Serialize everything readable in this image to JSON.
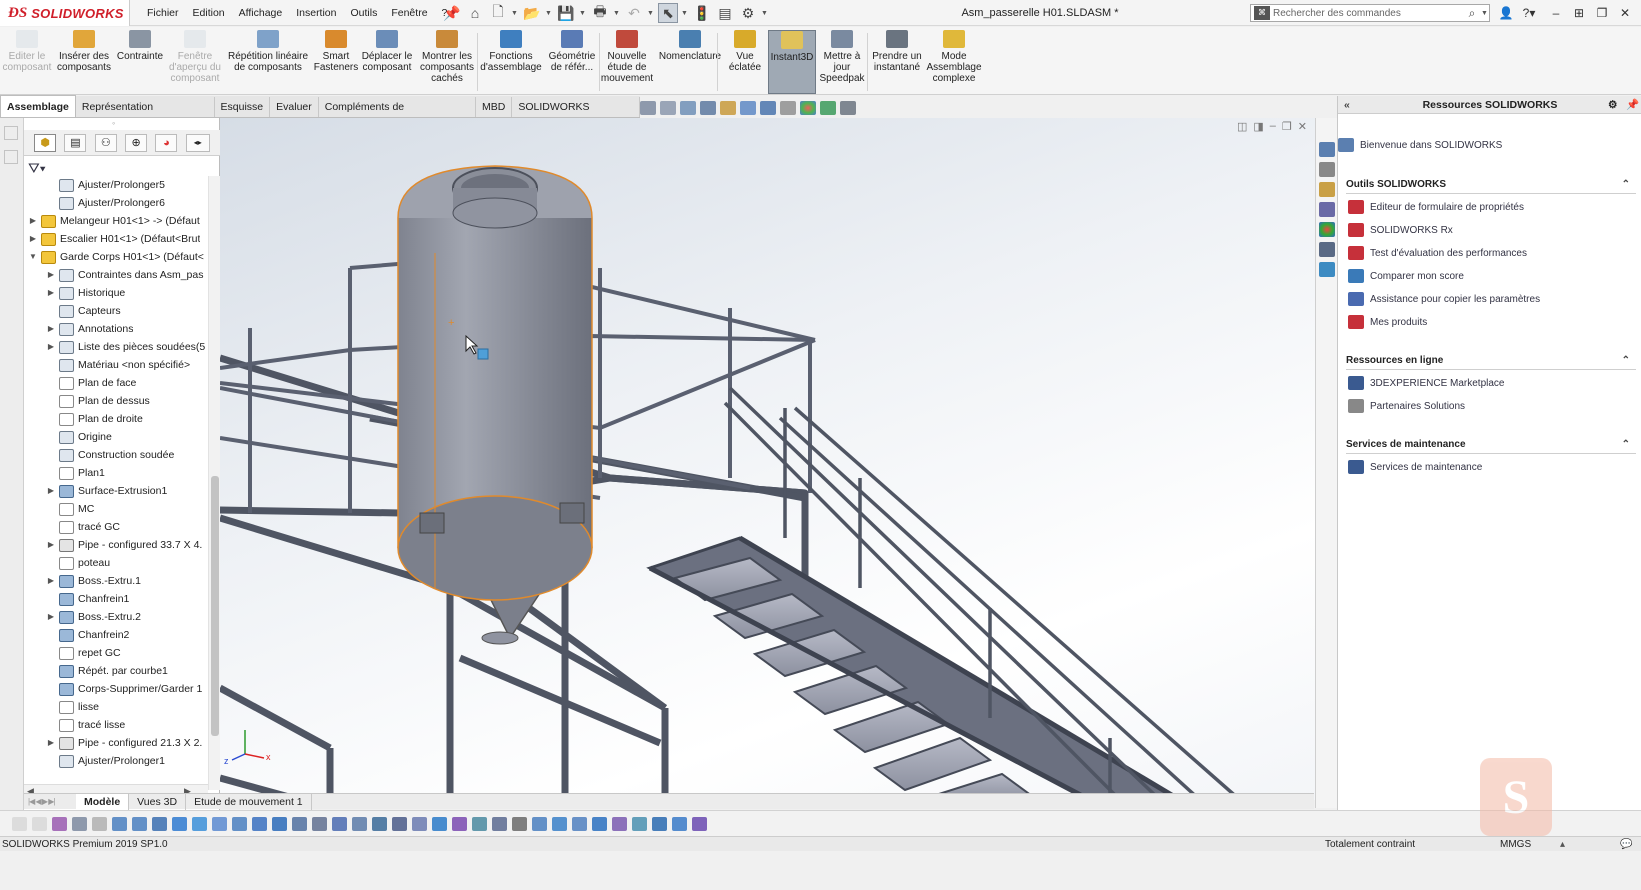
{
  "app": {
    "document_title": "Asm_passerelle H01.SLDASM *"
  },
  "menu": [
    "Fichier",
    "Edition",
    "Affichage",
    "Insertion",
    "Outils",
    "Fenêtre",
    "?"
  ],
  "search": {
    "placeholder": "Rechercher des commandes"
  },
  "commands": [
    {
      "label": "Editer le composant",
      "disabled": true
    },
    {
      "label": "Insérer des composants",
      "disabled": false
    },
    {
      "label": "Contrainte",
      "disabled": false
    },
    {
      "label": "Fenêtre d'aperçu du composant",
      "disabled": true
    },
    {
      "label": "Répétition linéaire de composants",
      "disabled": false
    },
    {
      "label": "Smart Fasteners",
      "disabled": false
    },
    {
      "label": "Déplacer le composant",
      "disabled": false
    },
    {
      "label": "Montrer les composants cachés",
      "disabled": false
    },
    {
      "label": "Fonctions d'assemblage",
      "disabled": false
    },
    {
      "label": "Géométrie de référ...",
      "disabled": false
    },
    {
      "label": "Nouvelle étude de mouvement",
      "disabled": false
    },
    {
      "label": "Nomenclature",
      "disabled": false
    },
    {
      "label": "Vue éclatée",
      "disabled": false
    },
    {
      "label": "Instant3D",
      "disabled": false,
      "active": true
    },
    {
      "label": "Mettre à jour Speedpak",
      "disabled": false
    },
    {
      "label": "Prendre un instantané",
      "disabled": false
    },
    {
      "label": "Mode Assemblage complexe",
      "disabled": false
    }
  ],
  "tabs": [
    "Assemblage",
    "Représentation schématique",
    "Esquisse",
    "Evaluer",
    "Compléments de SOLIDWORKS",
    "MBD",
    "SOLIDWORKS Inspection"
  ],
  "tree": [
    {
      "label": "Ajuster/Prolonger5",
      "indent": 2,
      "icon": "weld-trim-icon",
      "expand": ""
    },
    {
      "label": "Ajuster/Prolonger6",
      "indent": 2,
      "icon": "weld-trim-icon",
      "expand": ""
    },
    {
      "label": "Melangeur H01<1> -> (Défaut",
      "indent": 1,
      "icon": "assembly-icon",
      "expand": "▶"
    },
    {
      "label": "Escalier H01<1> (Défaut<Brut",
      "indent": 1,
      "icon": "assembly-icon",
      "expand": "▶"
    },
    {
      "label": "Garde Corps H01<1> (Défaut<",
      "indent": 1,
      "icon": "assembly-icon",
      "expand": "▼"
    },
    {
      "label": "Contraintes dans Asm_pas",
      "indent": 2,
      "icon": "mates-icon",
      "expand": "▶"
    },
    {
      "label": "Historique",
      "indent": 2,
      "icon": "history-icon",
      "expand": "▶"
    },
    {
      "label": "Capteurs",
      "indent": 2,
      "icon": "sensors-icon",
      "expand": ""
    },
    {
      "label": "Annotations",
      "indent": 2,
      "icon": "annotations-icon",
      "expand": "▶"
    },
    {
      "label": "Liste des pièces soudées(5",
      "indent": 2,
      "icon": "cut-list-icon",
      "expand": "▶"
    },
    {
      "label": "Matériau <non spécifié>",
      "indent": 2,
      "icon": "material-icon",
      "expand": ""
    },
    {
      "label": "Plan de face",
      "indent": 2,
      "icon": "plane-icon",
      "expand": ""
    },
    {
      "label": "Plan de dessus",
      "indent": 2,
      "icon": "plane-icon",
      "expand": ""
    },
    {
      "label": "Plan de droite",
      "indent": 2,
      "icon": "plane-icon",
      "expand": ""
    },
    {
      "label": "Origine",
      "indent": 2,
      "icon": "origin-icon",
      "expand": ""
    },
    {
      "label": "Construction soudée",
      "indent": 2,
      "icon": "weldment-icon",
      "expand": ""
    },
    {
      "label": "Plan1",
      "indent": 2,
      "icon": "plane-icon",
      "expand": ""
    },
    {
      "label": "Surface-Extrusion1",
      "indent": 2,
      "icon": "surface-icon",
      "expand": "▶"
    },
    {
      "label": "MC",
      "indent": 2,
      "icon": "sketch-icon",
      "expand": ""
    },
    {
      "label": "tracé GC",
      "indent": 2,
      "icon": "sketch-icon",
      "expand": ""
    },
    {
      "label": "Pipe - configured 33.7 X 4.",
      "indent": 2,
      "icon": "structural-member-icon",
      "expand": "▶"
    },
    {
      "label": "poteau",
      "indent": 2,
      "icon": "sketch-icon",
      "expand": ""
    },
    {
      "label": "Boss.-Extru.1",
      "indent": 2,
      "icon": "extrude-icon",
      "expand": "▶"
    },
    {
      "label": "Chanfrein1",
      "indent": 2,
      "icon": "chamfer-icon",
      "expand": ""
    },
    {
      "label": "Boss.-Extru.2",
      "indent": 2,
      "icon": "extrude-icon",
      "expand": "▶"
    },
    {
      "label": "Chanfrein2",
      "indent": 2,
      "icon": "chamfer-icon",
      "expand": ""
    },
    {
      "label": "repet GC",
      "indent": 2,
      "icon": "sketch-icon",
      "expand": ""
    },
    {
      "label": "Répét. par courbe1",
      "indent": 2,
      "icon": "pattern-icon",
      "expand": ""
    },
    {
      "label": "Corps-Supprimer/Garder 1",
      "indent": 2,
      "icon": "body-delete-icon",
      "expand": ""
    },
    {
      "label": "lisse",
      "indent": 2,
      "icon": "sketch-icon",
      "expand": ""
    },
    {
      "label": "tracé lisse",
      "indent": 2,
      "icon": "sketch-icon",
      "expand": ""
    },
    {
      "label": "Pipe - configured 21.3 X 2.",
      "indent": 2,
      "icon": "structural-member-icon",
      "expand": "▶"
    },
    {
      "label": "Ajuster/Prolonger1",
      "indent": 2,
      "icon": "weld-trim-icon",
      "expand": ""
    }
  ],
  "bottom_tabs": [
    "Modèle",
    "Vues 3D",
    "Etude de mouvement 1"
  ],
  "status": {
    "left": "SOLIDWORKS Premium 2019 SP1.0",
    "constraint": "Totalement contraint",
    "units": "MMGS"
  },
  "taskpane": {
    "title": "Ressources SOLIDWORKS",
    "welcome": "Bienvenue dans SOLIDWORKS",
    "sections": [
      {
        "title": "Outils SOLIDWORKS",
        "items": [
          "Editeur de formulaire de propriétés",
          "SOLIDWORKS Rx",
          "Test d'évaluation des performances",
          "Comparer mon score",
          "Assistance pour copier les paramètres",
          "Mes produits"
        ]
      },
      {
        "title": "Ressources en ligne",
        "items": [
          "3DEXPERIENCE Marketplace",
          "Partenaires Solutions"
        ]
      },
      {
        "title": "Services de maintenance",
        "items": [
          "Services de maintenance"
        ]
      }
    ]
  },
  "colors": {
    "brand": "#d01f2a",
    "selection": "#e08a2c",
    "steel": "#5d6270",
    "tank": "#8a8e99"
  }
}
